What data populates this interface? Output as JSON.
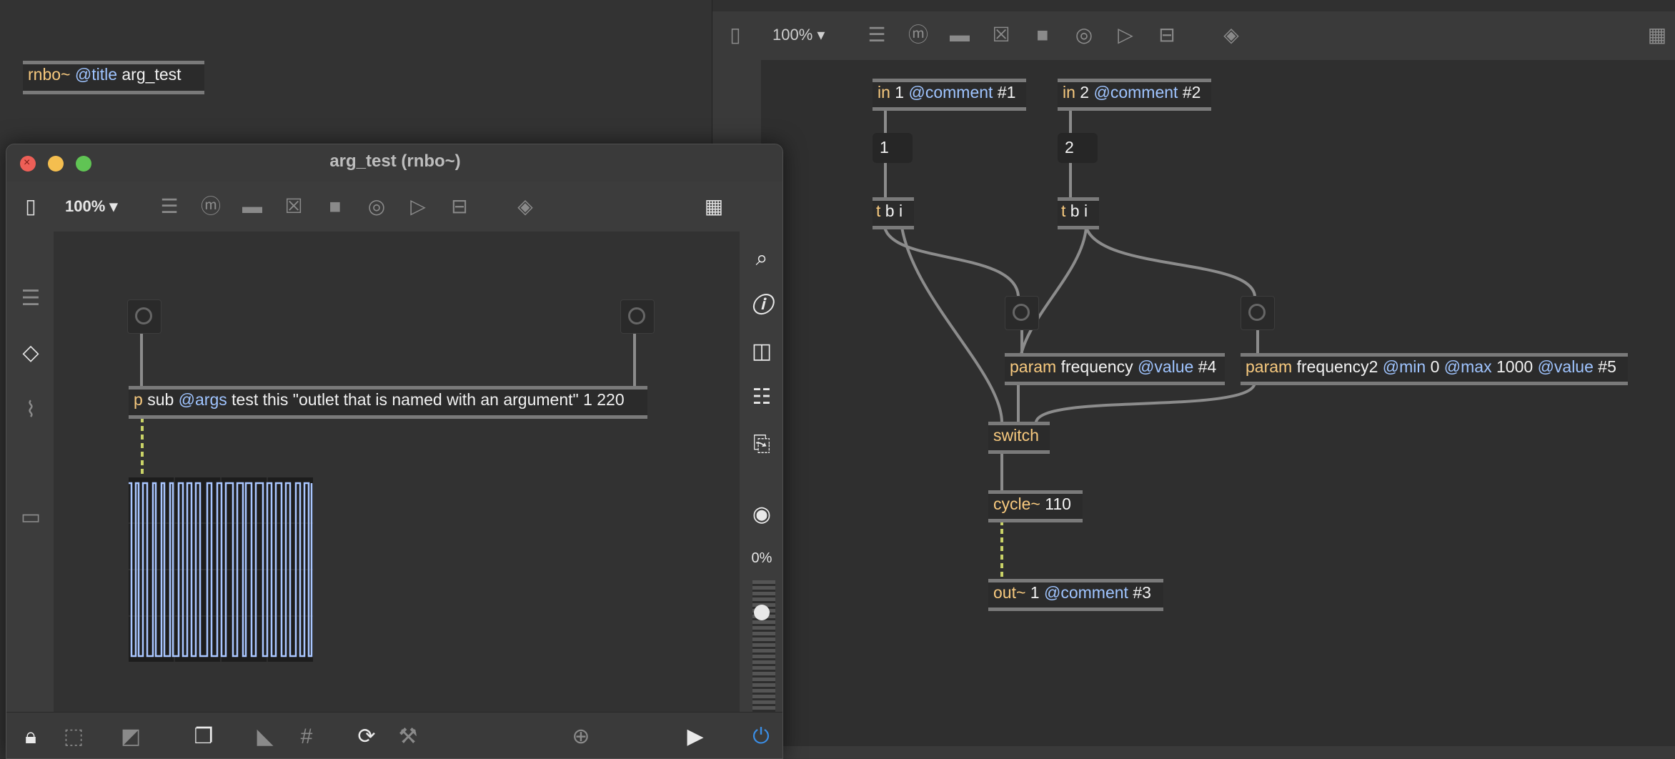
{
  "parent_object": {
    "keyword": "rnbo~",
    "attr": "@title",
    "value": "arg_test"
  },
  "right_editor": {
    "zoom": "100%",
    "objects": {
      "in1": {
        "keyword": "in",
        "rest": "1",
        "attr": "@comment",
        "value": "#1"
      },
      "in2": {
        "keyword": "in",
        "rest": "2",
        "attr": "@comment",
        "value": "#2"
      },
      "num1": "1",
      "num2": "2",
      "tbi1": {
        "keyword": "t",
        "rest": "b i"
      },
      "tbi2": {
        "keyword": "t",
        "rest": "b i"
      },
      "param1": {
        "keyword": "param",
        "rest": "frequency",
        "attr": "@value",
        "value": "#4"
      },
      "param2": {
        "keyword": "param",
        "rest": "frequency2",
        "attr1": "@min",
        "v1": "0",
        "attr2": "@max",
        "v2": "1000",
        "attr3": "@value",
        "v3": "#5"
      },
      "switch": {
        "keyword": "switch"
      },
      "cycle": {
        "keyword": "cycle~",
        "rest": "110"
      },
      "out": {
        "keyword": "out~",
        "rest": "1",
        "attr": "@comment",
        "value": "#3"
      }
    }
  },
  "window": {
    "title": "arg_test (rnbo~)",
    "zoom": "100%",
    "p_object": {
      "keyword": "p",
      "rest": "sub",
      "attr": "@args",
      "value": "test this \"outlet that is named with an argument\" 1 220"
    },
    "meter_percent": "0%",
    "scope_color": "#a9c6ff"
  },
  "colors": {
    "accent": "#f7c97e",
    "attr": "#9fc4ff",
    "power": "#3a8ee6",
    "bg": "#333333"
  }
}
